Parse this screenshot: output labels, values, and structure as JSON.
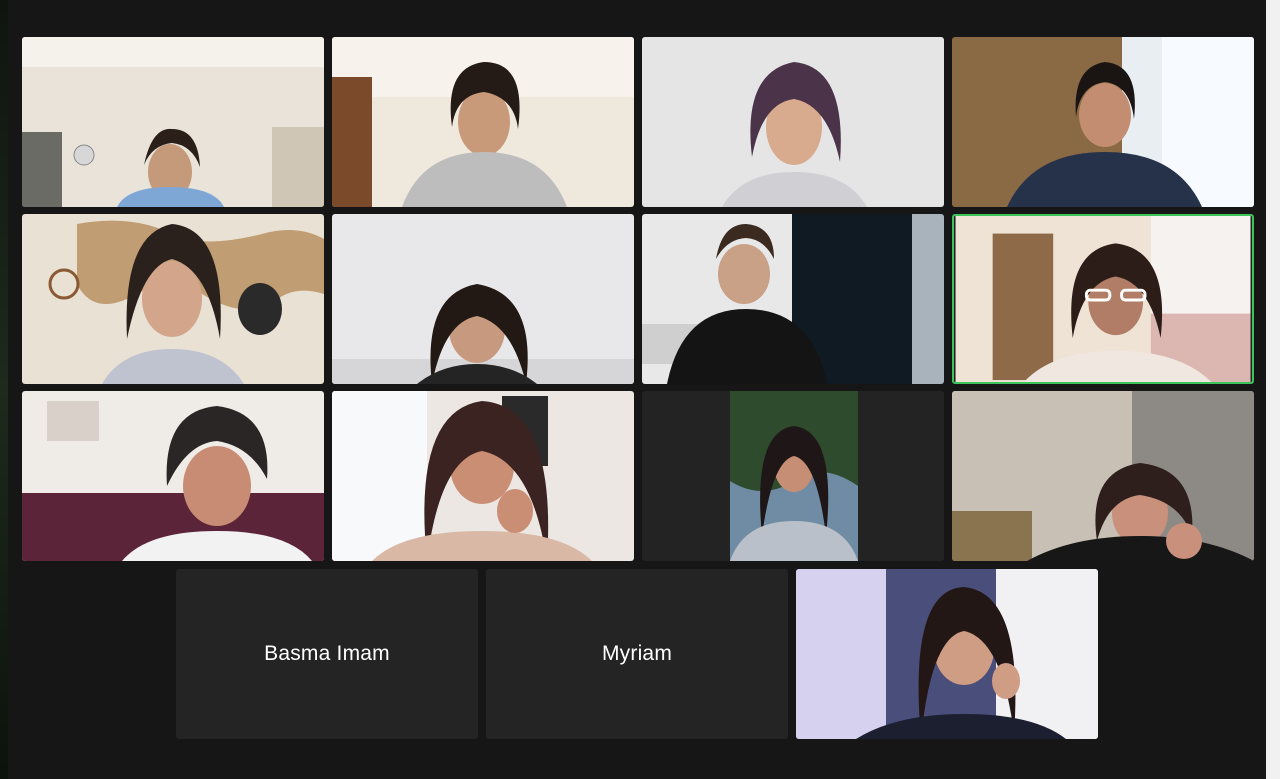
{
  "meeting": {
    "participants_no_video": [
      {
        "name": "Basma Imam"
      },
      {
        "name": "Myriam"
      }
    ],
    "active_speaker_index": 7
  },
  "colors": {
    "background": "#161616",
    "tile_empty": "#242424",
    "active_border": "#3cc35a",
    "name_text": "#ffffff"
  }
}
